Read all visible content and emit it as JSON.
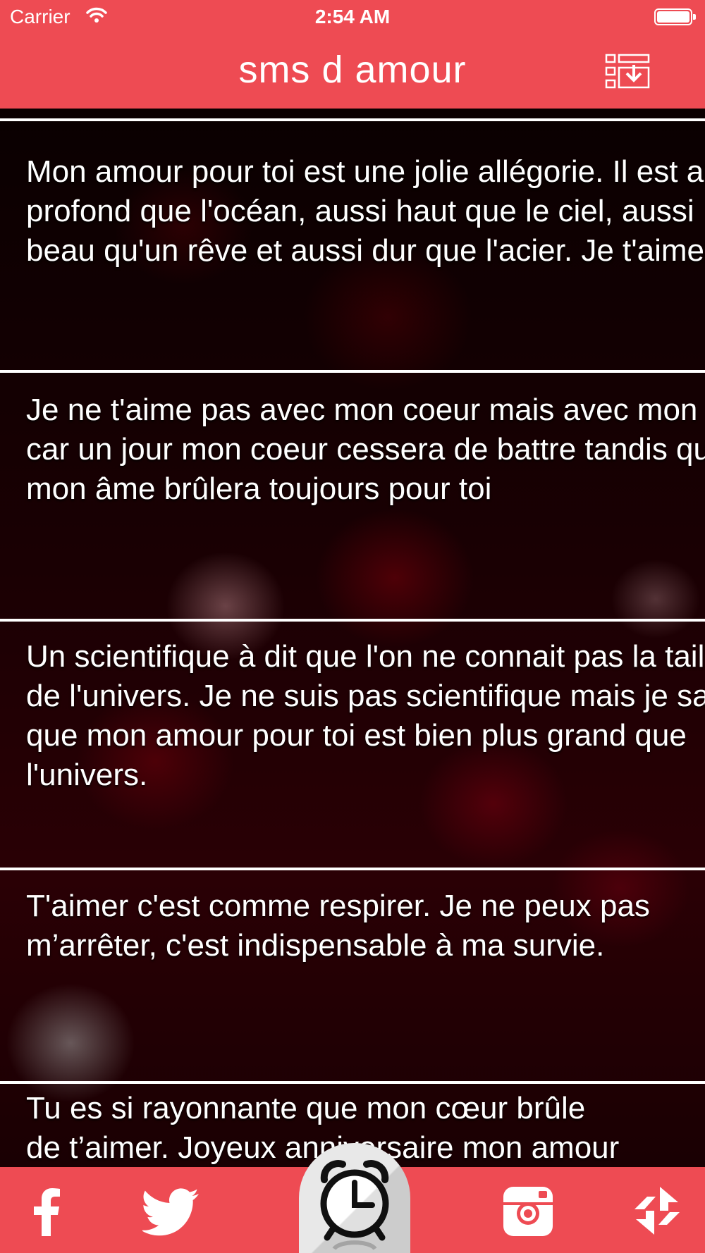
{
  "status_bar": {
    "carrier": "Carrier",
    "time": "2:54 AM"
  },
  "nav": {
    "title": "sms d amour",
    "action_icon": "download-list-icon"
  },
  "messages": [
    {
      "text": "Mon amour pour toi est une jolie allégorie. Il est aussi\nprofond que l'océan, aussi haut que le ciel, aussi\nbeau qu'un rêve et aussi dur que l'acier. Je t'aime"
    },
    {
      "text": "Je ne t'aime pas avec mon coeur mais avec mon âme\ncar un jour mon coeur cessera de battre tandis que\nmon âme brûlera toujours pour toi"
    },
    {
      "text": "Un scientifique à dit que l'on ne connait pas la taille\nde l'univers. Je ne suis pas scientifique mais je sais\nque mon amour pour toi est bien plus grand que\nl'univers."
    },
    {
      "text": "T'aimer c'est comme respirer. Je ne peux pas\nm’arrêter, c'est indispensable à ma survie."
    },
    {
      "text": "Tu es si rayonnante que mon cœur brûle\nde t’aimer. Joyeux anniversaire mon amour"
    }
  ],
  "tab_bar": {
    "items": [
      "facebook-icon",
      "twitter-icon",
      "alarm-clock-icon",
      "instagram-icon",
      "share-icon"
    ]
  },
  "colors": {
    "accent": "#ee4b53",
    "text": "#ffffff"
  }
}
